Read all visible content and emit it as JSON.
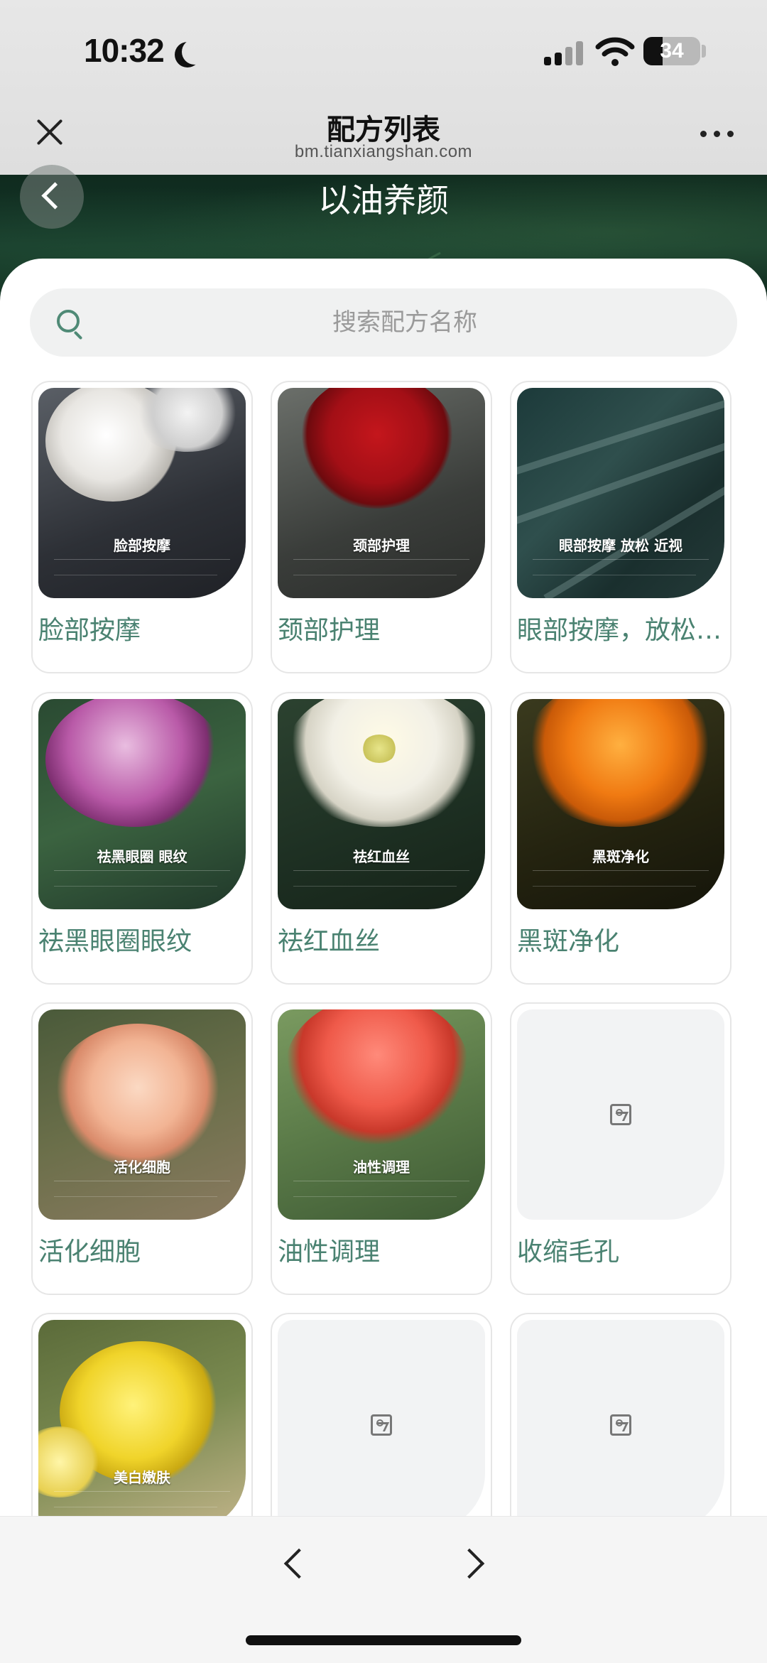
{
  "status_bar": {
    "time": "10:32",
    "battery": "34"
  },
  "browser": {
    "title": "配方列表",
    "url": "bm.tianxiangshan.com"
  },
  "hero": {
    "title": "以油养颜"
  },
  "search": {
    "placeholder": "搜索配方名称",
    "value": ""
  },
  "recipes": [
    {
      "label": "脸部按摩",
      "image_title": "脸部按摩",
      "has_image": true
    },
    {
      "label": "颈部护理",
      "image_title": "颈部护理",
      "has_image": true
    },
    {
      "label": "眼部按摩，放松 近视",
      "image_title": "眼部按摩 放松 近视",
      "has_image": true
    },
    {
      "label": "祛黑眼圈眼纹",
      "image_title": "祛黑眼圈 眼纹",
      "has_image": true
    },
    {
      "label": "祛红血丝",
      "image_title": "祛红血丝",
      "has_image": true
    },
    {
      "label": "黑斑净化",
      "image_title": "黑斑净化",
      "has_image": true
    },
    {
      "label": "活化细胞",
      "image_title": "活化细胞",
      "has_image": true
    },
    {
      "label": "油性调理",
      "image_title": "油性调理",
      "has_image": true
    },
    {
      "label": "收缩毛孔",
      "has_image": false
    },
    {
      "label": "",
      "image_title": "美白嫩肤",
      "has_image": true
    },
    {
      "label": "",
      "has_image": false
    },
    {
      "label": "",
      "has_image": false
    }
  ],
  "icons": {
    "close": "close-icon",
    "more": "more-icon",
    "back": "chevron-left-icon",
    "search": "search-icon",
    "placeholder": "image-icon",
    "prev": "chevron-left-icon",
    "next": "chevron-right-icon"
  },
  "colors": {
    "accent": "#4a8271",
    "hero_dark": "#0f2a1e"
  }
}
